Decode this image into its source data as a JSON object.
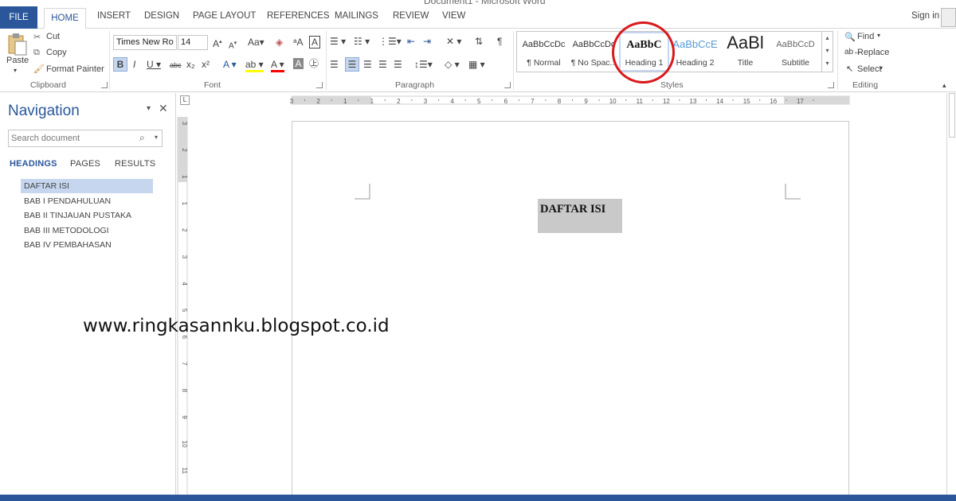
{
  "window": {
    "title": "Document1 - Microsoft Word",
    "sign_in": "Sign in"
  },
  "tabs": [
    "FILE",
    "HOME",
    "INSERT",
    "DESIGN",
    "PAGE LAYOUT",
    "REFERENCES",
    "MAILINGS",
    "REVIEW",
    "VIEW"
  ],
  "clipboard": {
    "paste": "Paste",
    "cut": "Cut",
    "copy": "Copy",
    "format_painter": "Format Painter",
    "label": "Clipboard"
  },
  "font": {
    "family": "Times New Ro",
    "size": "14",
    "label": "Font"
  },
  "paragraph": {
    "label": "Paragraph"
  },
  "styles": {
    "label": "Styles",
    "items": [
      {
        "preview": "AaBbCcDc",
        "name": "¶ Normal"
      },
      {
        "preview": "AaBbCcDc",
        "name": "¶ No Spac..."
      },
      {
        "preview": "AaBbC",
        "name": "Heading 1"
      },
      {
        "preview": "AaBbCcE",
        "name": "Heading 2"
      },
      {
        "preview": "AaBl",
        "name": "Title"
      },
      {
        "preview": "AaBbCcD",
        "name": "Subtitle"
      }
    ]
  },
  "editing": {
    "find": "Find",
    "replace": "Replace",
    "select": "Select",
    "label": "Editing"
  },
  "navigation": {
    "title": "Navigation",
    "search_placeholder": "Search document",
    "tabs": [
      "HEADINGS",
      "PAGES",
      "RESULTS"
    ],
    "headings": [
      "DAFTAR ISI",
      "BAB I PENDAHULUAN",
      "BAB II TINJAUAN PUSTAKA",
      "BAB III METODOLOGI",
      "BAB IV PEMBAHASAN"
    ]
  },
  "document": {
    "heading": "DAFTAR ISI"
  },
  "ruler": {
    "h_ticks": [
      "3",
      "2",
      "1",
      "1",
      "2",
      "3",
      "4",
      "5",
      "6",
      "7",
      "8",
      "9",
      "10",
      "11",
      "12",
      "13",
      "14",
      "15",
      "16",
      "17"
    ],
    "v_ticks": [
      "3",
      "2",
      "1",
      "1",
      "2",
      "3",
      "4",
      "5",
      "6",
      "7",
      "8",
      "9",
      "10",
      "11"
    ]
  },
  "watermark": "www.ringkasannku.blogspot.co.id",
  "colors": {
    "accent": "#2b579a",
    "selected_heading": "#c6d6ef",
    "highlight": "#d9191b"
  }
}
